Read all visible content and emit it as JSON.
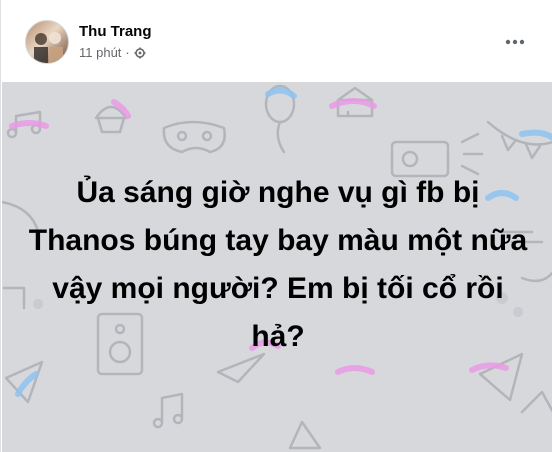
{
  "post": {
    "author": "Thu Trang",
    "time": "11 phút",
    "separator": "·",
    "privacy_icon": "settings-icon",
    "more_icon": "more-horizontal-icon",
    "text": "Ủa sáng giờ nghe vụ gì fb bị Thanos búng tay bay màu một nữa vậy mọi người? Em bị tối cổ rồi hả?"
  },
  "colors": {
    "background": "#d7d8db",
    "doodle_line": "#b3b5ba",
    "accent_pink": "#e99be6",
    "accent_blue": "#8fc3f0",
    "text": "#000000",
    "meta_text": "#65676b"
  }
}
